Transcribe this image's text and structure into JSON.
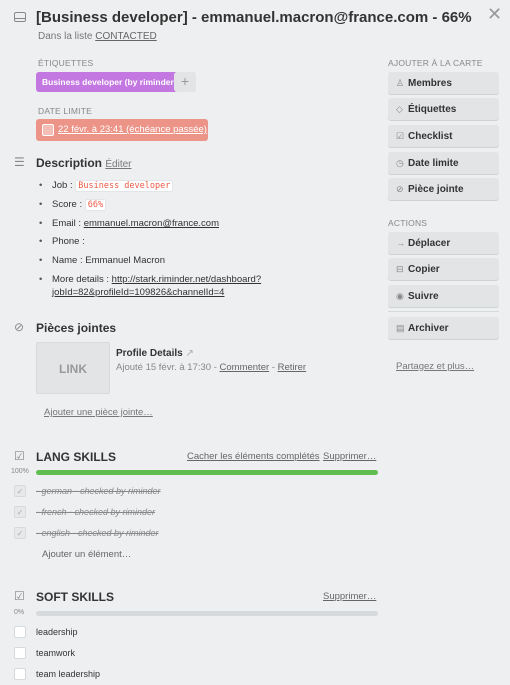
{
  "header": {
    "title": "[Business developer] - emmanuel.macron@france.com - 66%",
    "in_list_prefix": "Dans la liste",
    "list_name": "CONTACTED",
    "close": "✕"
  },
  "labels": {
    "heading": "ÉTIQUETTES",
    "items": [
      {
        "text": "Business developer (by riminder)",
        "color": "#c377e0"
      }
    ],
    "add": "+"
  },
  "due": {
    "heading": "DATE LIMITE",
    "text": "22 févr. à 23:41 (échéance passée)",
    "color": "#ec9488"
  },
  "description": {
    "title": "Description",
    "edit": "Éditer",
    "items": [
      {
        "label": "Job : ",
        "code": "Business developer"
      },
      {
        "label": "Score : ",
        "code": "66%"
      },
      {
        "label": "Email : ",
        "link": "emmanuel.macron@france.com"
      },
      {
        "label": "Phone : "
      },
      {
        "label": "Name : Emmanuel Macron"
      },
      {
        "label": "More details : ",
        "link_line1": "http://stark.riminder.net/dashboard?",
        "link_line2": "jobId=82&profileId=109826&channelId=4"
      }
    ]
  },
  "attachments": {
    "title": "Pièces jointes",
    "thumb": "LINK",
    "name": "Profile Details",
    "added": "Ajouté 15 févr. à 17:30 - ",
    "comment": "Commenter",
    "sep": " - ",
    "remove": "Retirer",
    "add": "Ajouter une pièce jointe…"
  },
  "checklists": [
    {
      "title": "LANG SKILLS",
      "hide": "Cacher les éléments complétés",
      "delete": "Supprimer…",
      "percent_label": "100%",
      "progress": 1.0,
      "items": [
        {
          "text": "- german - checked by riminder",
          "done": true
        },
        {
          "text": "- french - checked by riminder",
          "done": true
        },
        {
          "text": "- english - checked by riminder",
          "done": true
        }
      ],
      "add": "Ajouter un élément…"
    },
    {
      "title": "SOFT SKILLS",
      "delete": "Supprimer…",
      "percent_label": "0%",
      "progress": 0.0,
      "items": [
        {
          "text": "leadership",
          "done": false
        },
        {
          "text": "teamwork",
          "done": false
        },
        {
          "text": "team leadership",
          "done": false
        }
      ]
    }
  ],
  "sidebar": {
    "add_heading": "AJOUTER À LA CARTE",
    "add_buttons": [
      {
        "icon": "person-icon",
        "glyph": "♙",
        "label": "Membres"
      },
      {
        "icon": "tag-icon",
        "glyph": "◇",
        "label": "Étiquettes"
      },
      {
        "icon": "checklist-icon",
        "glyph": "☑",
        "label": "Checklist"
      },
      {
        "icon": "clock-icon",
        "glyph": "◷",
        "label": "Date limite"
      },
      {
        "icon": "paperclip-icon",
        "glyph": "⊘",
        "label": "Pièce jointe"
      }
    ],
    "actions_heading": "ACTIONS",
    "action_buttons": [
      {
        "icon": "arrow-right-icon",
        "glyph": "→",
        "label": "Déplacer"
      },
      {
        "icon": "copy-icon",
        "glyph": "⊟",
        "label": "Copier"
      },
      {
        "icon": "eye-icon",
        "glyph": "◉",
        "label": "Suivre"
      },
      {
        "icon": "archive-icon",
        "glyph": "▤",
        "label": "Archiver"
      }
    ],
    "share": "Partagez et plus…"
  }
}
